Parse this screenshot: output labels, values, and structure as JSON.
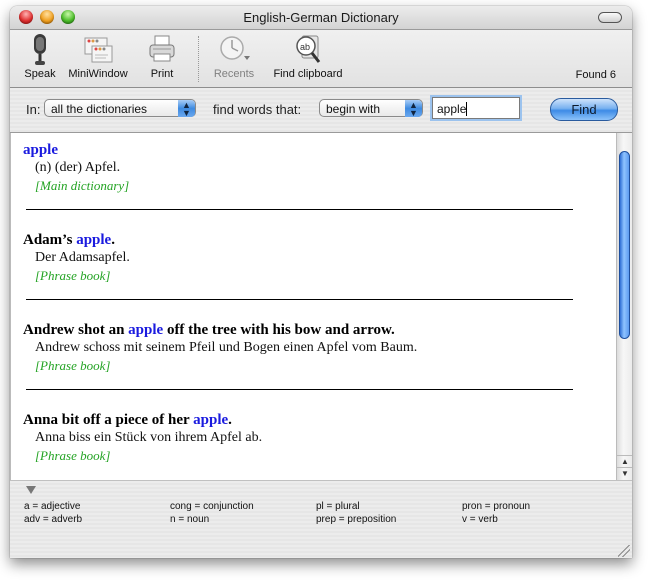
{
  "window": {
    "title": "English-German Dictionary"
  },
  "toolbar": {
    "items": [
      {
        "label": "Speak",
        "icon": "microphone-icon",
        "enabled": true
      },
      {
        "label": "MiniWindow",
        "icon": "miniwindow-icon",
        "enabled": true
      },
      {
        "label": "Print",
        "icon": "printer-icon",
        "enabled": true
      },
      {
        "label": "Recents",
        "icon": "clock-icon",
        "enabled": false
      },
      {
        "label": "Find clipboard",
        "icon": "clipboard-search-icon",
        "enabled": true
      }
    ],
    "found_label": "Found 6"
  },
  "search": {
    "in_label": "In:",
    "dictionary_selected": "all the dictionaries",
    "find_label": "find words that:",
    "match_selected": "begin with",
    "query": "apple",
    "find_button": "Find"
  },
  "results": [
    {
      "head_pre": "",
      "head_hl": "apple",
      "head_post": "",
      "translation": "(n) (der) Apfel.",
      "source": "[Main dictionary]"
    },
    {
      "head_pre": "Adam’s ",
      "head_hl": "apple",
      "head_post": ".",
      "translation": "Der Adamsapfel.",
      "source": "[Phrase book]"
    },
    {
      "head_pre": "Andrew shot an ",
      "head_hl": "apple",
      "head_post": " off the tree with his bow and arrow.",
      "translation": "Andrew schoss mit seinem Pfeil und Bogen einen Apfel vom Baum.",
      "source": "[Phrase book]"
    },
    {
      "head_pre": "Anna bit off a piece of her ",
      "head_hl": "apple",
      "head_post": ".",
      "translation": "Anna biss ein Stück von ihrem Apfel ab.",
      "source": "[Phrase book]"
    }
  ],
  "scroll": {
    "up_glyph": "▲",
    "down_glyph": "▼"
  },
  "legend": {
    "items": [
      "a = adjective",
      "adv = adverb",
      "cong = conjunction",
      "n = noun",
      "pl = plural",
      "prep = preposition",
      "pron = pronoun",
      "v = verb"
    ]
  },
  "colors": {
    "highlight": "#1a1adf",
    "source": "#23a323",
    "accent": "#3d8be6"
  }
}
